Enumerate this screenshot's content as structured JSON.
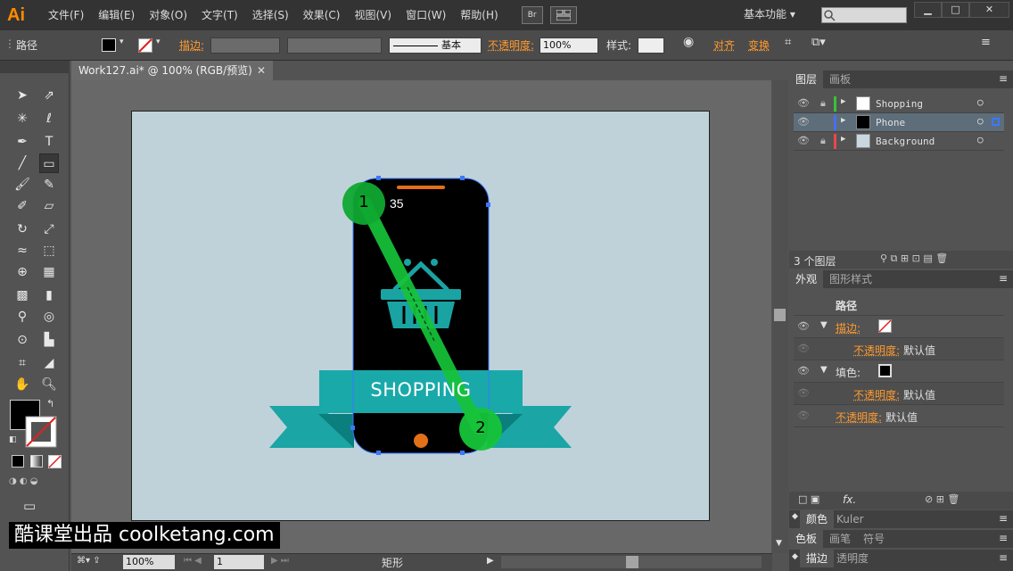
{
  "app": {
    "logo": "Ai"
  },
  "menu": [
    "文件(F)",
    "编辑(E)",
    "对象(O)",
    "文字(T)",
    "选择(S)",
    "效果(C)",
    "视图(V)",
    "窗口(W)",
    "帮助(H)"
  ],
  "menu_extra": {
    "bridge": "Br",
    "workspace": "基本功能"
  },
  "control": {
    "object_type": "路径",
    "stroke_label": "描边:",
    "brush_style": "基本",
    "opacity_label": "不透明度:",
    "opacity_value": "100%",
    "style_label": "样式:",
    "align_label": "对齐",
    "transform_label": "变换"
  },
  "document": {
    "tab_title": "Work127.ai* @ 100% (RGB/预览)"
  },
  "artwork": {
    "phone_number": "35",
    "banner_text": "SHOPPING",
    "marker1": "1",
    "marker2": "2",
    "colors": {
      "phone": "#000000",
      "banner": "#19a9a9",
      "banner_dark": "#0d8d8d",
      "accent": "#e87017",
      "marker": "#16c43a"
    }
  },
  "status": {
    "zoom": "100%",
    "page": "1",
    "tool": "矩形"
  },
  "layers_panel": {
    "tabs": [
      "图层",
      "画板"
    ],
    "layers": [
      {
        "name": "Shopping",
        "color": "#3ac23a"
      },
      {
        "name": "Phone",
        "color": "#4a6ef0"
      },
      {
        "name": "Background",
        "color": "#e84848"
      }
    ],
    "count": "3 个图层"
  },
  "appearance_panel": {
    "tabs": [
      "外观",
      "图形样式"
    ],
    "title": "路径",
    "stroke": "描边:",
    "stroke_opacity_label": "不透明度:",
    "stroke_opacity_value": "默认值",
    "fill": "填色:",
    "fill_opacity_label": "不透明度:",
    "fill_opacity_value": "默认值",
    "opacity_label": "不透明度:",
    "opacity_value": "默认值",
    "fx": "fx."
  },
  "bottom_panels": {
    "color_tabs": [
      "颜色",
      "Kuler"
    ],
    "swatch_tabs": [
      "色板",
      "画笔",
      "符号"
    ],
    "trans_tabs": [
      "描边",
      "透明度"
    ]
  },
  "watermark": "酷课堂出品 coolketang.com"
}
